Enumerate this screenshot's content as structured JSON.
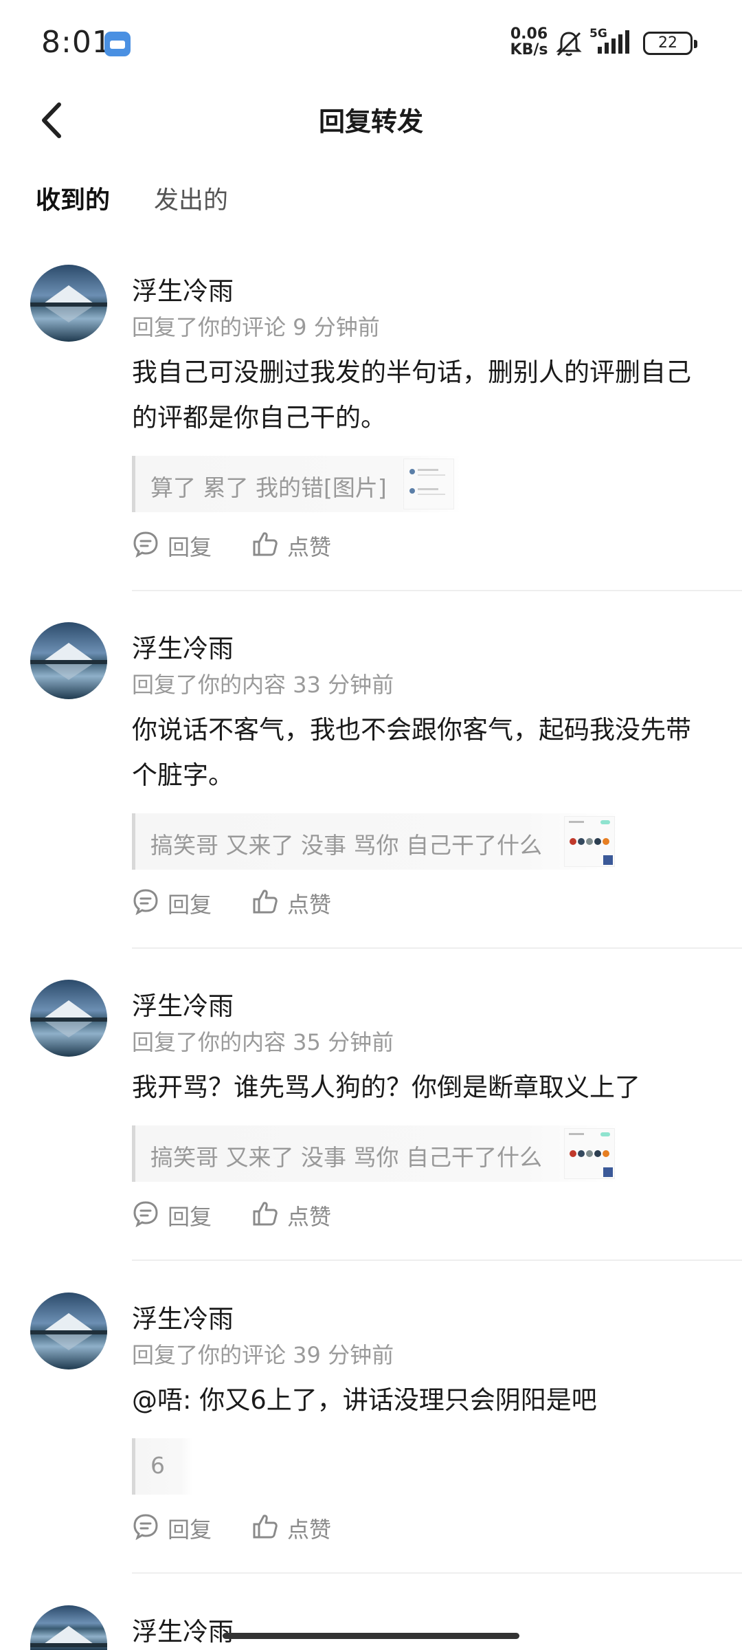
{
  "status_bar": {
    "time": "8:01",
    "net_speed_value": "0.06",
    "net_speed_unit": "KB/s",
    "network": "5G",
    "battery": "22"
  },
  "header": {
    "title": "回复转发",
    "back_icon": "chevron-left-icon"
  },
  "tabs": [
    {
      "label": "收到的",
      "active": true
    },
    {
      "label": "发出的",
      "active": false
    }
  ],
  "items": [
    {
      "username": "浮生冷雨",
      "meta": "回复了你的评论 9 分钟前",
      "content": "我自己可没删过我发的半句话，删别人的评删自己的评都是你自己干的。",
      "quote": "算了 累了  我的错[图片]",
      "reply_label": "回复",
      "like_label": "点赞"
    },
    {
      "username": "浮生冷雨",
      "meta": "回复了你的内容 33 分钟前",
      "content": "你说话不客气，我也不会跟你客气，起码我没先带个脏字。",
      "quote": "搞笑哥 又来了 没事 骂你 自己干了什么",
      "reply_label": "回复",
      "like_label": "点赞"
    },
    {
      "username": "浮生冷雨",
      "meta": "回复了你的内容 35 分钟前",
      "content": "我开骂？谁先骂人狗的？你倒是断章取义上了",
      "quote": "搞笑哥 又来了 没事 骂你 自己干了什么",
      "reply_label": "回复",
      "like_label": "点赞"
    },
    {
      "username": "浮生冷雨",
      "meta": "回复了你的评论 39 分钟前",
      "content": "@唔: 你又6上了，讲话没理只会阴阳是吧",
      "quote": "6",
      "reply_label": "回复",
      "like_label": "点赞"
    },
    {
      "username": "浮生冷雨"
    }
  ],
  "colors": {
    "accent": "#35d2b3",
    "muted_text": "#9a9a9a"
  }
}
